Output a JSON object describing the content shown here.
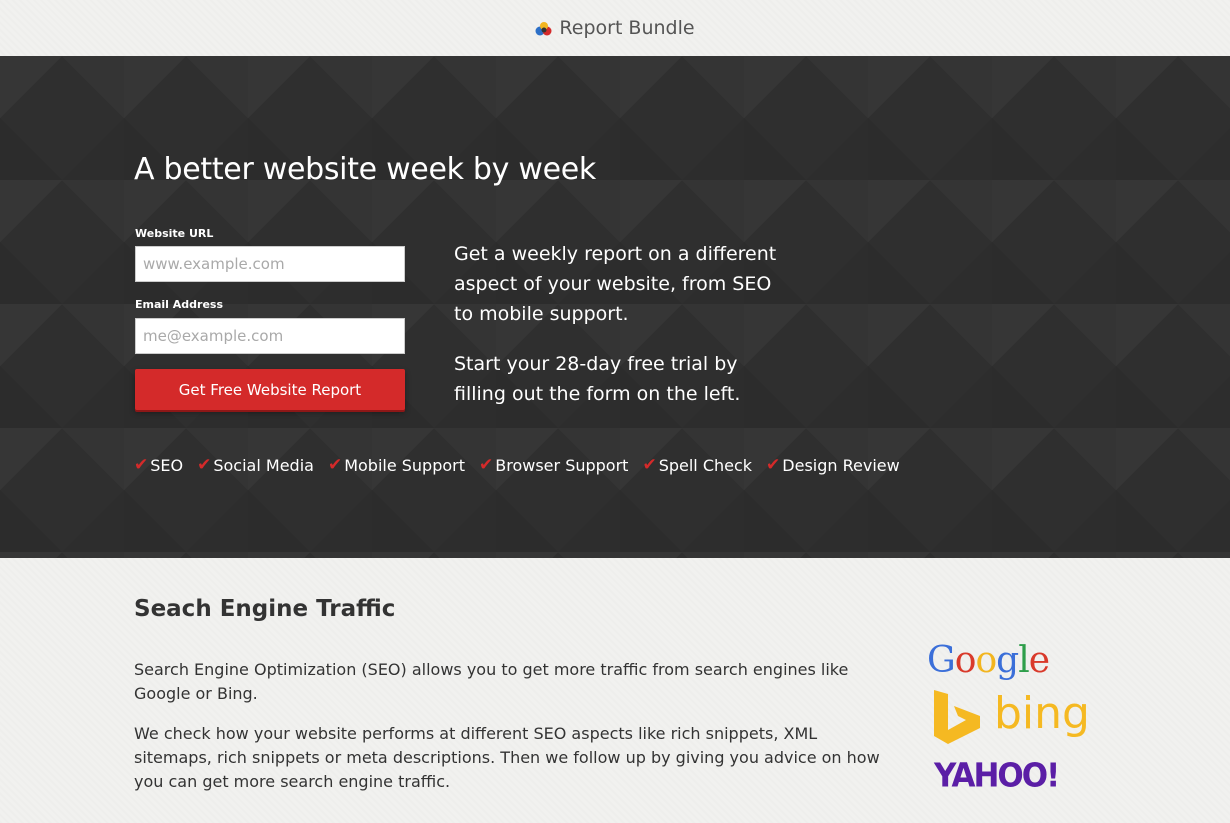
{
  "header": {
    "brand_name": "Report Bundle",
    "logo_icon": "report-bundle-logo-icon"
  },
  "hero": {
    "title": "A better website week by week",
    "form": {
      "url_label": "Website URL",
      "url_placeholder": "www.example.com",
      "email_label": "Email Address",
      "email_placeholder": "me@example.com",
      "submit_label": "Get Free Website Report"
    },
    "description_1": "Get a weekly report on a different aspect of your website, from SEO to mobile support.",
    "description_2": "Start your 28-day free trial by filling out the form on the left.",
    "features": [
      "SEO",
      "Social Media",
      "Mobile Support",
      "Browser Support",
      "Spell Check",
      "Design Review"
    ],
    "check_glyph": "✔"
  },
  "section": {
    "title": "Seach Engine Traffic",
    "paragraph_1": "Search Engine Optimization (SEO) allows you to get more traffic from search engines like Google or Bing.",
    "paragraph_2": "We check how your website performs at different SEO aspects like rich snippets, XML sitemaps, rich snippets or meta descriptions. Then we follow up by giving you advice on how you can get more search engine traffic."
  },
  "logos": {
    "google": "Google",
    "bing": "bing",
    "yahoo": "YAHOO!"
  },
  "colors": {
    "hero_bg": "#2f2f2f",
    "accent_red": "#d42a2a",
    "bing_yellow": "#f5b922",
    "yahoo_purple": "#5b1ea6"
  }
}
